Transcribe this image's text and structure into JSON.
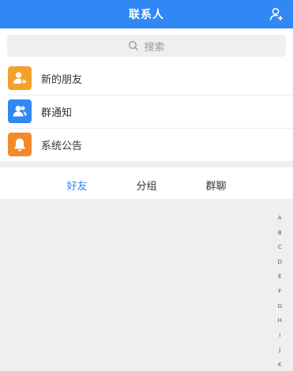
{
  "header": {
    "title": "联系人"
  },
  "search": {
    "placeholder": "搜索"
  },
  "menu": [
    {
      "label": "新的朋友",
      "color": "#f4a12b",
      "icon": "add-friend-icon"
    },
    {
      "label": "群通知",
      "color": "#2f88f4",
      "icon": "group-notice-icon"
    },
    {
      "label": "系统公告",
      "color": "#f4892b",
      "icon": "bell-icon"
    }
  ],
  "tabs": [
    {
      "label": "好友",
      "active": true
    },
    {
      "label": "分组",
      "active": false
    },
    {
      "label": "群聊",
      "active": false
    }
  ],
  "index_letters": [
    "A",
    "B",
    "C",
    "D",
    "E",
    "F",
    "G",
    "H",
    "I",
    "J",
    "K"
  ],
  "colors": {
    "primary": "#2f88f4",
    "background": "#efefef"
  }
}
